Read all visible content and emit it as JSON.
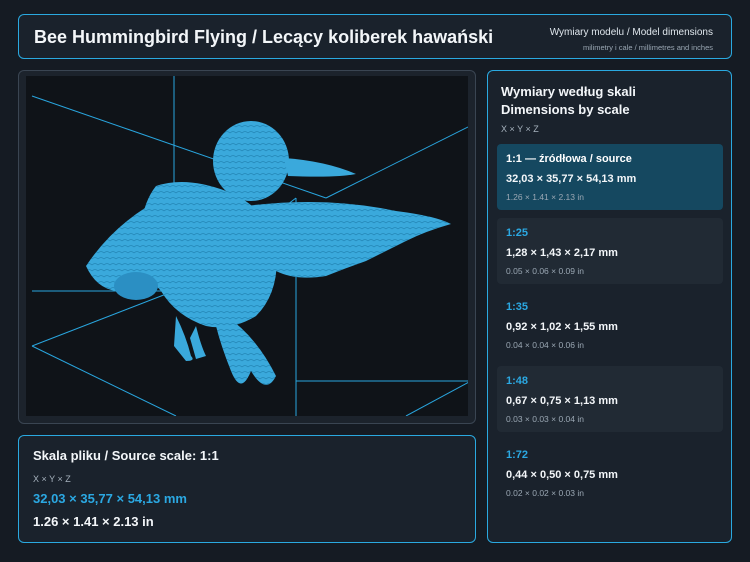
{
  "header": {
    "title": "Bee Hummingbird Flying / Lecący koliberek hawański",
    "subtitle": "Wymiary modelu / Model dimensions",
    "caption": "milimetry i cale / millimetres and inches"
  },
  "source": {
    "title": "Skala pliku / Source scale: 1:1",
    "axes": "X × Y × Z",
    "mm": "32,03 × 35,77 × 54,13 mm",
    "inches": "1.26 × 1.41 × 2.13 in"
  },
  "scales": {
    "title_line1": "Wymiary według skali",
    "title_line2": "Dimensions by scale",
    "axes": "X × Y × Z",
    "items": [
      {
        "label": "1:1  —  źródłowa / source",
        "mm": "32,03 × 35,77 × 54,13 mm",
        "inches": "1.26 × 1.41 × 2.13 in"
      },
      {
        "label": "1:25",
        "mm": "1,28 × 1,43 × 2,17 mm",
        "inches": "0.05 × 0.06 × 0.09 in"
      },
      {
        "label": "1:35",
        "mm": "0,92 × 1,02 × 1,55 mm",
        "inches": "0.04 × 0.04 × 0.06 in"
      },
      {
        "label": "1:48",
        "mm": "0,67 × 0,75 × 1,13 mm",
        "inches": "0.03 × 0.03 × 0.04 in"
      },
      {
        "label": "1:72",
        "mm": "0,44 × 0,50 × 0,75 mm",
        "inches": "0.02 × 0.02 × 0.03 in"
      }
    ]
  },
  "colors": {
    "accent": "#2aa9e0",
    "model": "#3aa9dc",
    "background": "#151b23",
    "active_card": "#154860"
  }
}
